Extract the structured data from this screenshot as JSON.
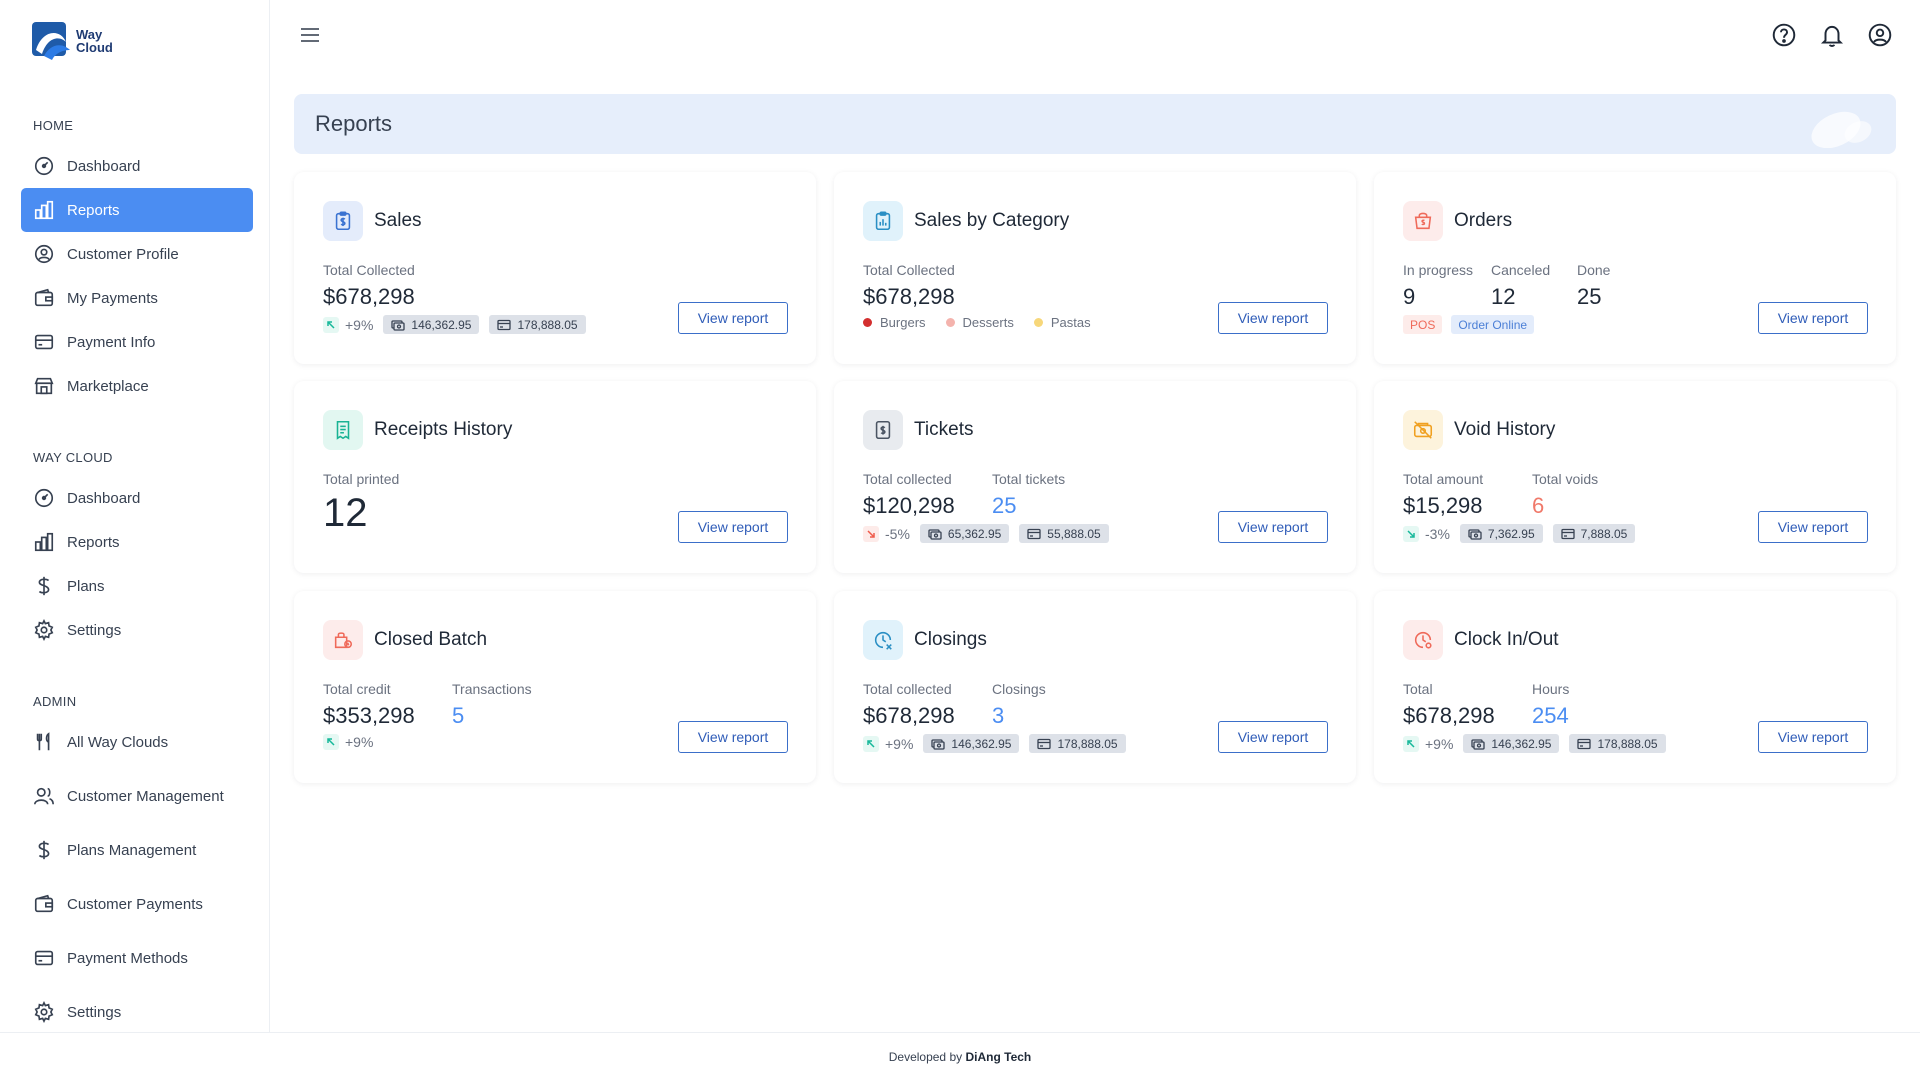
{
  "brand": {
    "line1": "Way",
    "line2": "Cloud"
  },
  "sidebar": {
    "sections": [
      {
        "label": "HOME",
        "items": [
          {
            "label": "Dashboard",
            "icon": "dashboard-icon",
            "active": false
          },
          {
            "label": "Reports",
            "icon": "reports-icon",
            "active": true
          },
          {
            "label": "Customer Profile",
            "icon": "user-circle-icon",
            "active": false
          },
          {
            "label": "My Payments",
            "icon": "wallet-icon",
            "active": false
          },
          {
            "label": "Payment Info",
            "icon": "credit-card-icon",
            "active": false
          },
          {
            "label": "Marketplace",
            "icon": "store-icon",
            "active": false
          }
        ]
      },
      {
        "label": "WAY CLOUD",
        "items": [
          {
            "label": "Dashboard",
            "icon": "dashboard-icon",
            "active": false
          },
          {
            "label": "Reports",
            "icon": "reports-icon",
            "active": false
          },
          {
            "label": "Plans",
            "icon": "dollar-icon",
            "active": false
          },
          {
            "label": "Settings",
            "icon": "gear-icon",
            "active": false
          }
        ]
      },
      {
        "label": "ADMIN",
        "items": [
          {
            "label": "All Way Clouds",
            "icon": "utensils-icon",
            "active": false
          },
          {
            "label": "Customer Management",
            "icon": "users-icon",
            "active": false
          },
          {
            "label": "Plans Management",
            "icon": "dollar-icon",
            "active": false
          },
          {
            "label": "Customer Payments",
            "icon": "wallet-icon",
            "active": false
          },
          {
            "label": "Payment Methods",
            "icon": "credit-card-icon",
            "active": false
          },
          {
            "label": "Settings",
            "icon": "gear-icon",
            "active": false
          }
        ]
      }
    ]
  },
  "topbar": {
    "icons": [
      "menu-icon",
      "help-icon",
      "bell-icon",
      "account-icon"
    ]
  },
  "page": {
    "title": "Reports"
  },
  "cards": {
    "sales": {
      "title": "Sales",
      "label": "Total Collected",
      "value": "$678,298",
      "trend": "+9%",
      "cash": "146,362.95",
      "card": "178,888.05",
      "button": "View report"
    },
    "sales_by_category": {
      "title": "Sales by Category",
      "label": "Total Collected",
      "value": "$678,298",
      "legend": [
        {
          "label": "Burgers",
          "color": "#d32f2f"
        },
        {
          "label": "Desserts",
          "color": "#f4b3ad"
        },
        {
          "label": "Pastas",
          "color": "#f7d77a"
        }
      ],
      "button": "View report"
    },
    "orders": {
      "title": "Orders",
      "stats": [
        {
          "label": "In progress",
          "value": "9"
        },
        {
          "label": "Canceled",
          "value": "12"
        },
        {
          "label": "Done",
          "value": "25"
        }
      ],
      "tags": [
        "POS",
        "Order Online"
      ],
      "button": "View report"
    },
    "receipts": {
      "title": "Receipts History",
      "label": "Total printed",
      "value": "12",
      "button": "View report"
    },
    "tickets": {
      "title": "Tickets",
      "label1": "Total collected",
      "value1": "$120,298",
      "label2": "Total tickets",
      "value2": "25",
      "trend": "-5%",
      "cash": "65,362.95",
      "card": "55,888.05",
      "button": "View report"
    },
    "void": {
      "title": "Void History",
      "label1": "Total amount",
      "value1": "$15,298",
      "label2": "Total voids",
      "value2": "6",
      "trend": "-3%",
      "cash": "7,362.95",
      "card": "7,888.05",
      "button": "View report"
    },
    "closed_batch": {
      "title": "Closed Batch",
      "label1": "Total credit",
      "value1": "$353,298",
      "label2": "Transactions",
      "value2": "5",
      "trend": "+9%",
      "button": "View report"
    },
    "closings": {
      "title": "Closings",
      "label1": "Total collected",
      "value1": "$678,298",
      "label2": "Closings",
      "value2": "3",
      "trend": "+9%",
      "cash": "146,362.95",
      "card": "178,888.05",
      "button": "View report"
    },
    "clock": {
      "title": "Clock In/Out",
      "label1": "Total",
      "value1": "$678,298",
      "label2": "Hours",
      "value2": "254",
      "trend": "+9%",
      "cash": "146,362.95",
      "card": "178,888.05",
      "button": "View report"
    }
  },
  "footer": {
    "prefix": "Developed by",
    "company": "DiAng Tech"
  },
  "colors": {
    "accent": "#4b8df2",
    "header_bg": "#e6eefb",
    "button_border": "#3b6fc9"
  }
}
